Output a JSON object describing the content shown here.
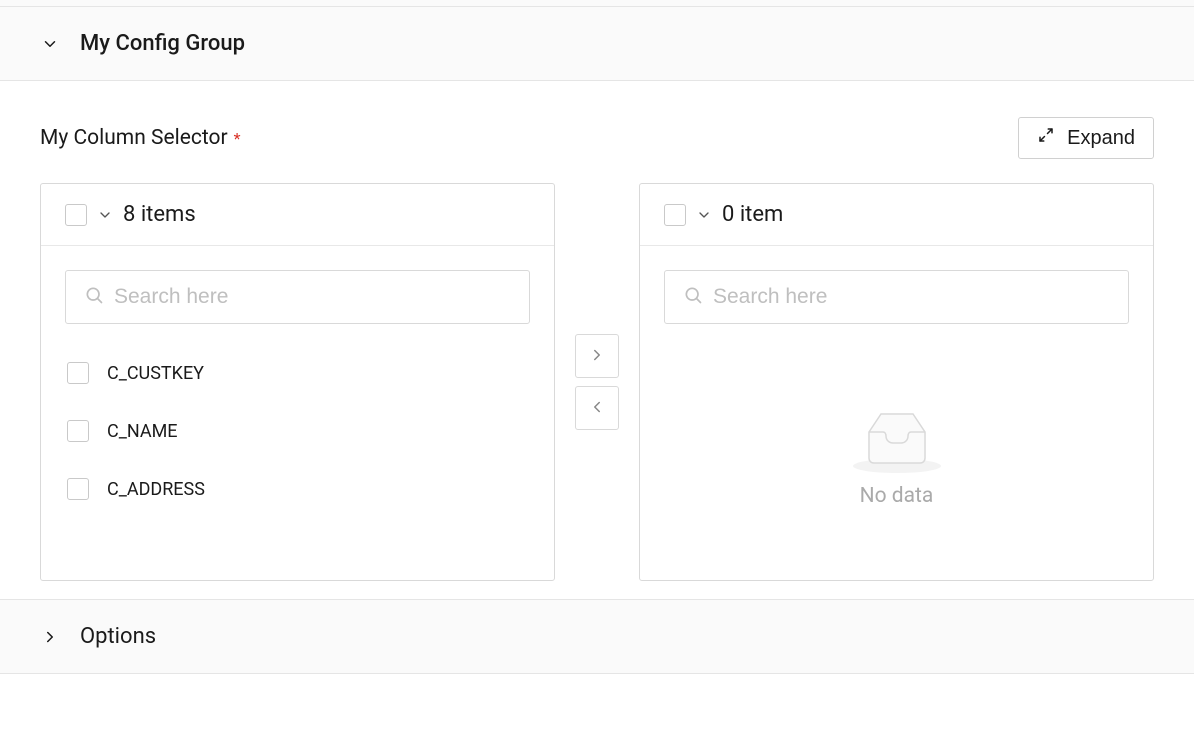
{
  "configGroup": {
    "title": "My Config Group"
  },
  "columnSelector": {
    "label": "My Column Selector",
    "expandLabel": "Expand",
    "leftPanel": {
      "count": "8 items",
      "searchPlaceholder": "Search here",
      "items": [
        {
          "label": "C_CUSTKEY"
        },
        {
          "label": "C_NAME"
        },
        {
          "label": "C_ADDRESS"
        }
      ]
    },
    "rightPanel": {
      "count": "0 item",
      "searchPlaceholder": "Search here",
      "emptyLabel": "No data"
    }
  },
  "options": {
    "title": "Options"
  }
}
